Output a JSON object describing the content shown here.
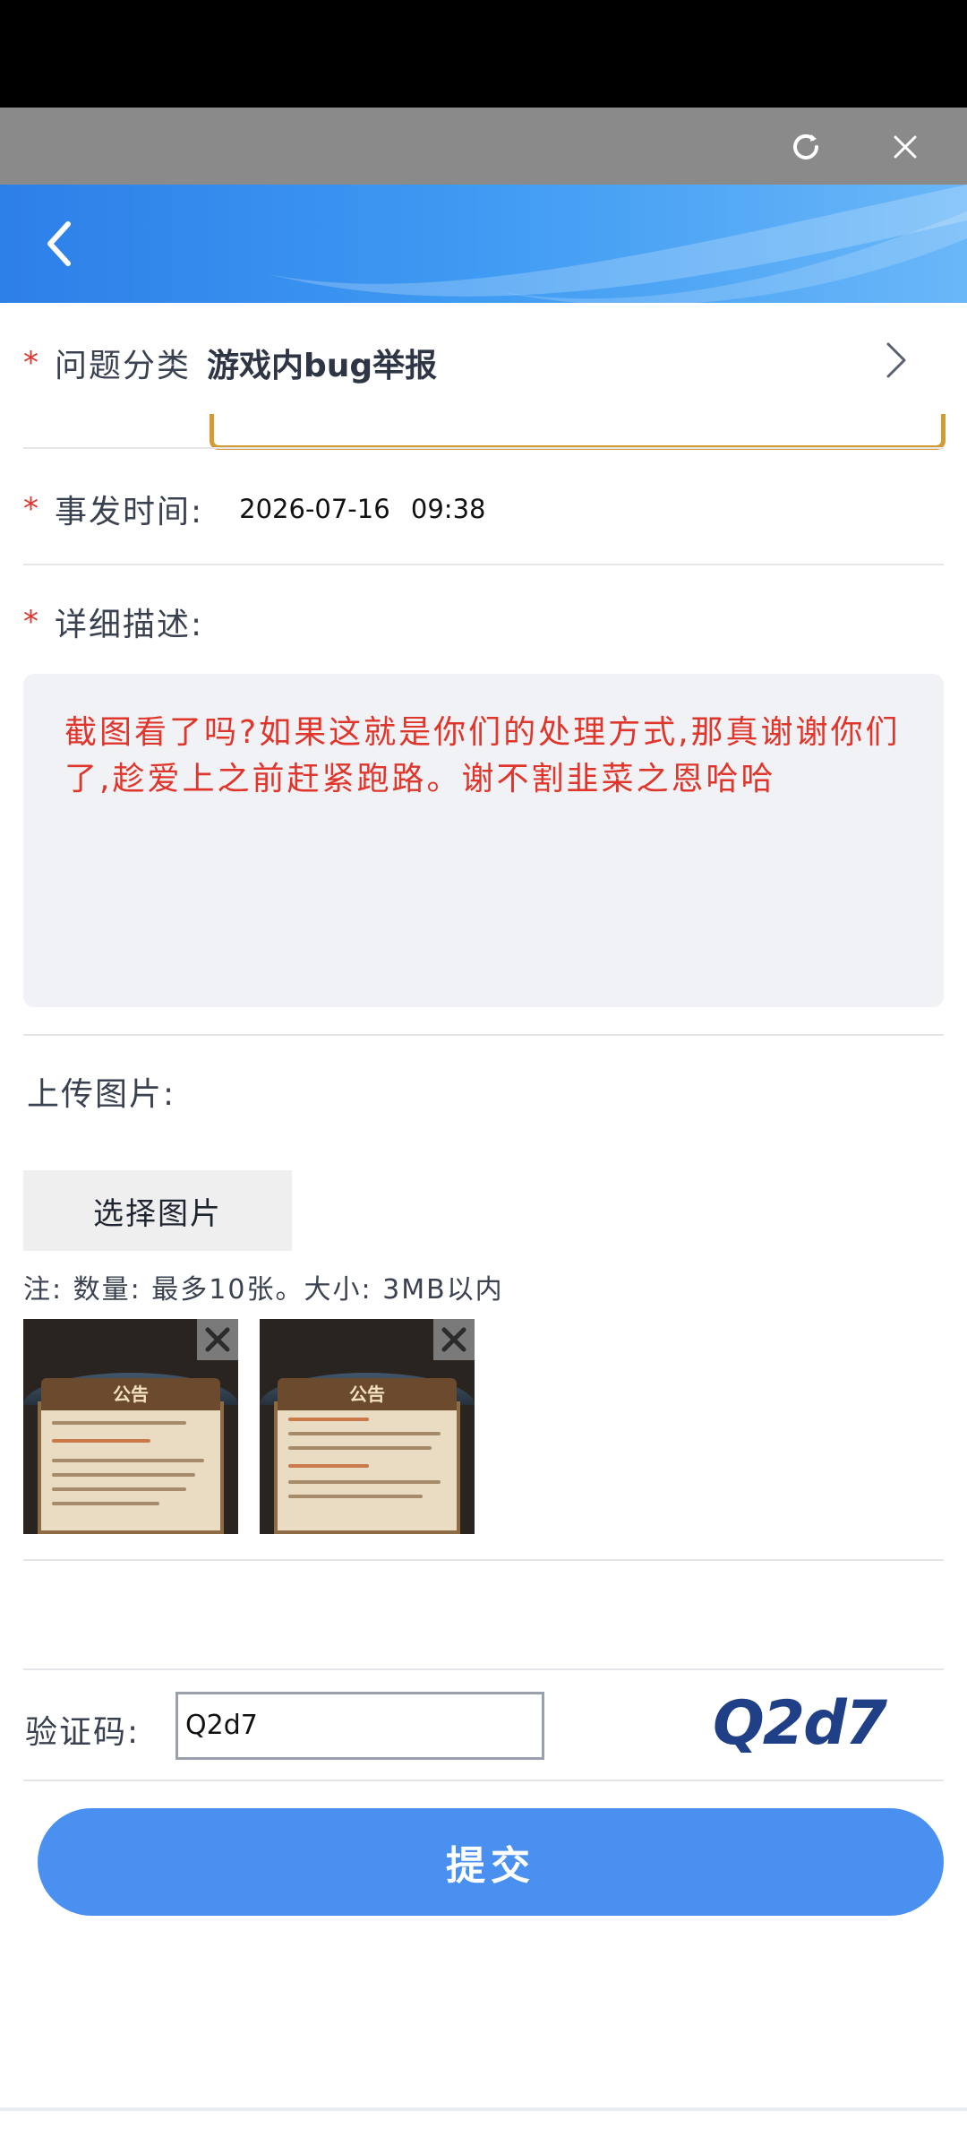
{
  "form": {
    "category_label": "问题分类",
    "category_value": "游戏内bug举报",
    "time_label": "事发时间:",
    "time_value": "2026-07-16  09:38",
    "desc_label": "详细描述:",
    "desc_text": "截图看了吗?如果这就是你们的处理方式,那真谢谢你们了,趁爱上之前赶紧跑路。谢不割韭菜之恩哈哈",
    "upload_label": "上传图片:",
    "choose_button": "选择图片",
    "upload_note": "注: 数量: 最多10张。大小: 3MB以内",
    "captcha_label": "验证码:",
    "captcha_value": "Q2d7",
    "captcha_image_text": "Q2d7",
    "submit_label": "提交"
  },
  "thumbnails": [
    {
      "title": "公告"
    },
    {
      "title": "公告"
    }
  ],
  "colors": {
    "accent": "#4a90f0",
    "required": "#e0352b",
    "header_gradient": "#3f9bf3"
  },
  "icons": {
    "refresh": "refresh-icon",
    "close": "close-icon",
    "back": "back-chevron-icon",
    "chevron": "chevron-right-icon",
    "remove": "remove-image-icon"
  }
}
